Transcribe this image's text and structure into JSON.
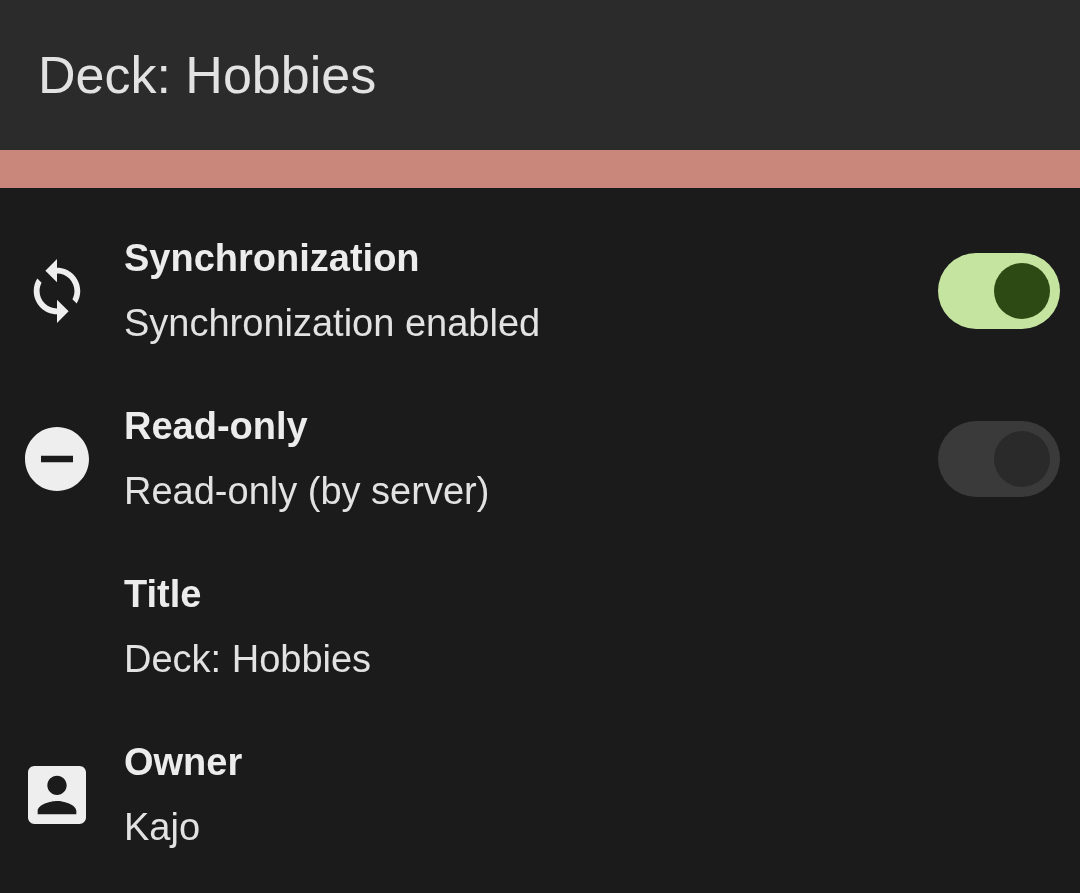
{
  "header": {
    "title": "Deck: Hobbies"
  },
  "rows": [
    {
      "kind": "switch",
      "title": "Synchronization",
      "subtitle": "Synchronization enabled",
      "on": true,
      "disabled": false
    },
    {
      "kind": "switch",
      "title": "Read-only",
      "subtitle": "Read-only (by server)",
      "on": true,
      "disabled": true
    },
    {
      "kind": "text",
      "title": "Title",
      "subtitle": "Deck: Hobbies"
    },
    {
      "kind": "text",
      "title": "Owner",
      "subtitle": "Kajo"
    }
  ]
}
